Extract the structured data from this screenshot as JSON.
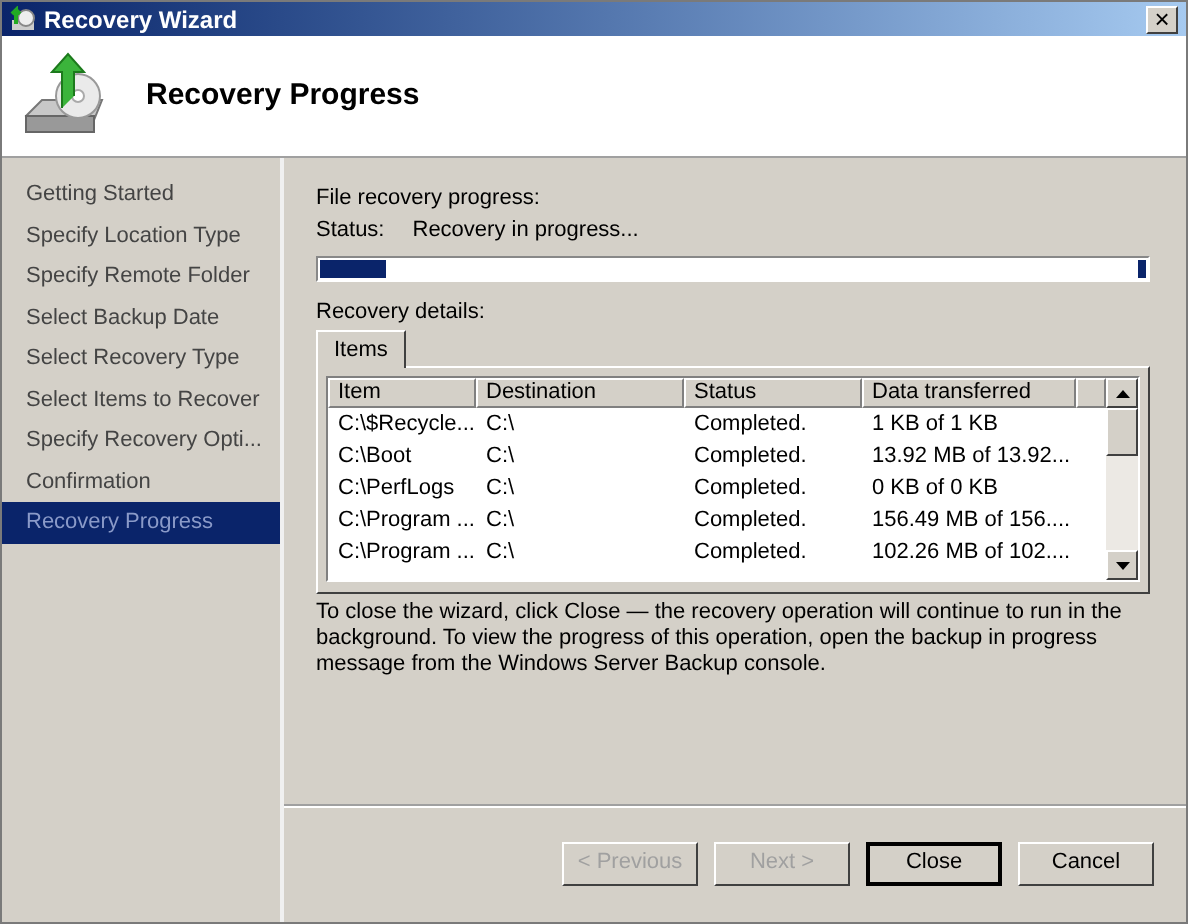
{
  "window": {
    "title": "Recovery Wizard",
    "close": "×"
  },
  "header": {
    "title": "Recovery Progress"
  },
  "steps": [
    {
      "label": "Getting Started",
      "selected": false
    },
    {
      "label": "Specify Location Type",
      "selected": false
    },
    {
      "label": "Specify Remote Folder",
      "selected": false
    },
    {
      "label": "Select Backup Date",
      "selected": false
    },
    {
      "label": "Select Recovery Type",
      "selected": false
    },
    {
      "label": "Select Items to Recover",
      "selected": false
    },
    {
      "label": "Specify Recovery Opti...",
      "selected": false
    },
    {
      "label": "Confirmation",
      "selected": false
    },
    {
      "label": "Recovery Progress",
      "selected": true
    }
  ],
  "progress": {
    "label": "File recovery progress:",
    "status_label": "Status:",
    "status": "Recovery in progress...",
    "level": 0.08
  },
  "details": {
    "label": "Recovery details:",
    "tabs": [
      {
        "label": "Items",
        "selected": true
      }
    ],
    "columns": [
      "Item",
      "Destination",
      "Status",
      "Data transferred"
    ],
    "rows": [
      [
        "C:\\$Recycle...",
        "C:\\",
        "Completed.",
        "1 KB of 1 KB"
      ],
      [
        "C:\\Boot",
        "C:\\",
        "Completed.",
        "13.92 MB of 13.92..."
      ],
      [
        "C:\\PerfLogs",
        "C:\\",
        "Completed.",
        "0 KB of 0 KB"
      ],
      [
        "C:\\Program ...",
        "C:\\",
        "Completed.",
        "156.49 MB of 156...."
      ],
      [
        "C:\\Program ...",
        "C:\\",
        "Completed.",
        "102.26 MB of 102...."
      ]
    ]
  },
  "note": "To close the wizard, click Close — the recovery operation will continue to run in the background. To view the progress of this operation, open the backup in progress message from the Windows Server Backup console.",
  "buttons": [
    {
      "label": "< Previous",
      "disabled": true,
      "default": false
    },
    {
      "label": "Next >",
      "disabled": true,
      "default": false
    },
    {
      "label": "Close",
      "disabled": false,
      "default": true
    },
    {
      "label": "Cancel",
      "disabled": false,
      "default": false
    }
  ]
}
